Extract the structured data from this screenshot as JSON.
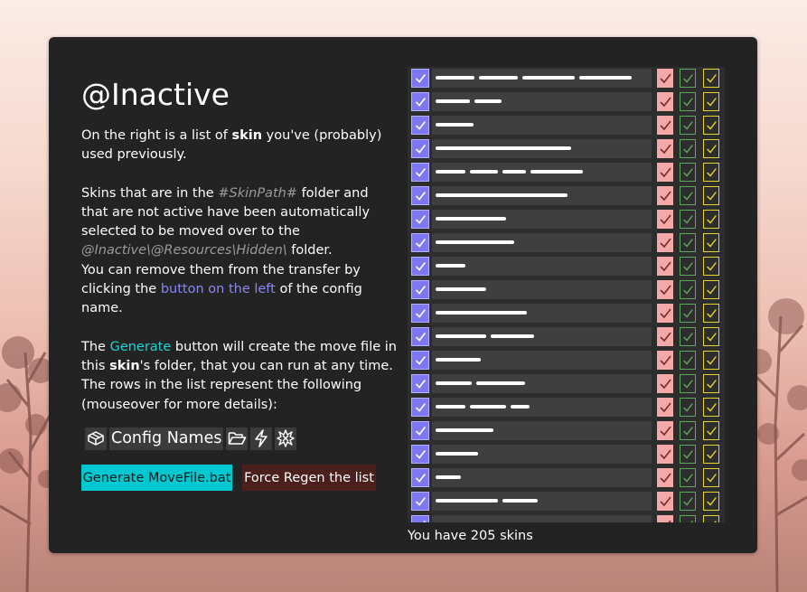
{
  "page": {
    "title": "@Inactive",
    "intro_pre": "On the right is a list of ",
    "intro_bold": "skin",
    "intro_post": " you've (probably) used previously.",
    "p2_a": "Skins that are in the ",
    "p2_skinpath": "#SkinPath#",
    "p2_b": " folder and that are not active have been automatically selected to be moved over to the ",
    "p2_dest": "@Inactive\\@Resources\\Hidden\\",
    "p2_c": " folder.",
    "p3_a": "You can remove them from the transfer by clicking the ",
    "p3_link": "button on the left",
    "p3_b": " of the config name.",
    "p4_a": "The ",
    "p4_link": "Generate",
    "p4_b": " button will create the move file in this ",
    "p4_bold": "skin",
    "p4_c": "'s folder, that you can run at any time.",
    "p5": "The rows in the list represent the following (mouseover for more details):",
    "legend_label": "Config Names",
    "generate_button": "Generate MoveFile.bat",
    "regen_button": "Force Regen the list",
    "footer": "You have 205 skins"
  },
  "icons": {
    "legend": [
      "package-icon",
      "folder-icon",
      "lightning-icon",
      "burst-icon"
    ],
    "row_cells": [
      "select-checkbox-icon",
      "red-check-icon",
      "green-check-icon",
      "yellow-check-icon"
    ]
  },
  "colors": {
    "select": "#7d78f2",
    "red": "#f4a9a9",
    "green": "#5da85d",
    "yellow": "#e6d331",
    "generate": "#00c8d0",
    "regen": "#4a1f1c"
  }
}
